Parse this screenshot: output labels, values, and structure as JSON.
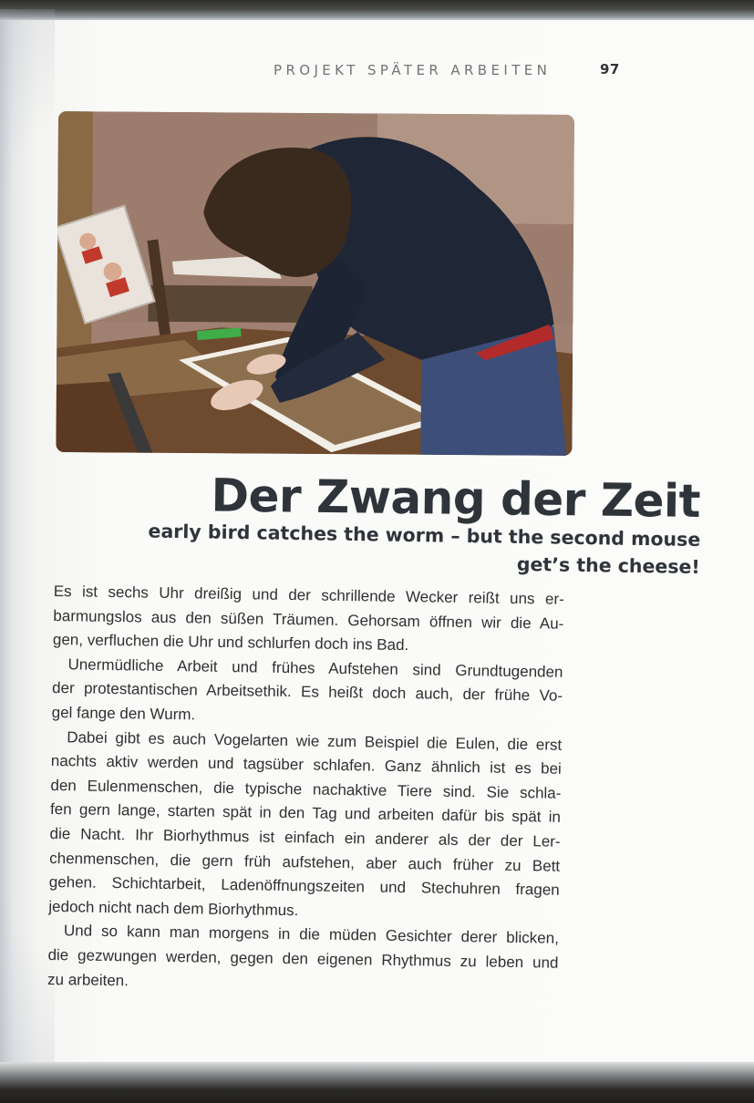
{
  "running_head": {
    "section": "PROJEKT SPÄTER ARBEITEN",
    "page_number": "97"
  },
  "photo": {
    "subject": "person-framing-pictures-at-table"
  },
  "article": {
    "headline": "Der Zwang der Zeit",
    "subheadline_line1": "early bird catches the worm –  but the second mouse",
    "subheadline_line2": "get’s the cheese!",
    "paragraphs": [
      {
        "lines": [
          "Es ist sechs Uhr dreißig und der schrillende Wecker reißt uns er-",
          "barmungslos aus den süßen Träumen. Gehorsam öffnen wir die Au-",
          "gen, verfluchen die Uhr und schlurfen doch ins Bad."
        ]
      },
      {
        "lines": [
          "Unermüdliche Arbeit und frühes Aufstehen sind Grundtugenden",
          "der protestantischen Arbeitsethik. Es heißt doch auch, der frühe Vo-",
          "gel fange den Wurm."
        ]
      },
      {
        "lines": [
          "Dabei gibt es auch Vogelarten wie zum Beispiel die Eulen, die erst",
          "nachts aktiv werden und tagsüber schlafen. Ganz ähnlich ist es bei",
          "den Eulenmenschen, die typische nachaktive Tiere sind. Sie schla-",
          "fen gern lange, starten spät in den Tag und arbeiten dafür bis spät in",
          "die Nacht. Ihr Biorhythmus ist einfach ein anderer als der der Ler-",
          "chenmenschen, die gern früh aufstehen, aber auch früher zu Bett",
          "gehen. Schichtarbeit, Ladenöffnungszeiten und Stechuhren fragen",
          "jedoch nicht nach dem Biorhythmus."
        ]
      },
      {
        "lines": [
          "Und so kann man morgens in die müden Gesichter derer blicken,",
          "die gezwungen werden, gegen den eigenen Rhythmus zu leben und",
          "zu arbeiten."
        ]
      }
    ]
  },
  "colors": {
    "headline": "#2f343b",
    "body": "#303030",
    "running_head": "#737373",
    "paper": "#fbfbf9"
  }
}
